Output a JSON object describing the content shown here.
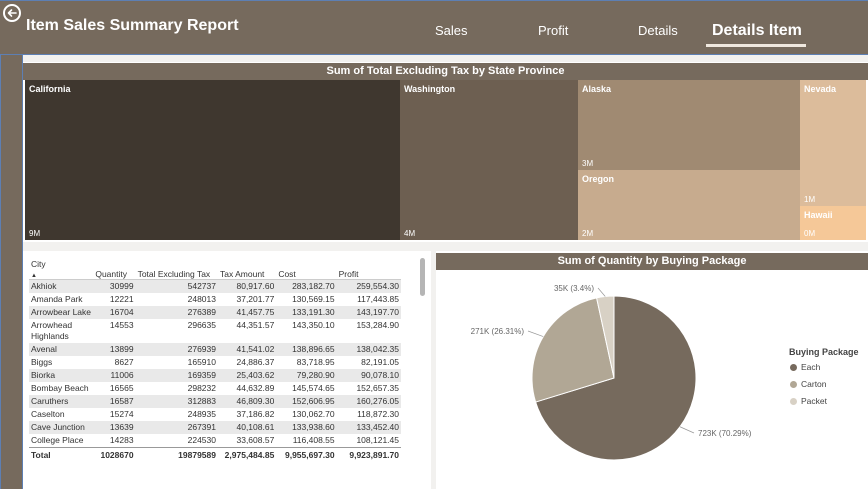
{
  "header": {
    "title": "Item Sales Summary Report",
    "nav": [
      "Sales",
      "Profit",
      "Details",
      "Details Item"
    ]
  },
  "treemap": {
    "title": "Sum of Total Excluding Tax by State Province",
    "tiles": [
      {
        "label": "California",
        "value": "9M",
        "color": "#3f372f"
      },
      {
        "label": "Washington",
        "value": "4M",
        "color": "#6d5f51"
      },
      {
        "label": "Alaska",
        "value": "3M",
        "color": "#a08a72"
      },
      {
        "label": "Oregon",
        "value": "2M",
        "color": "#c7ab8e"
      },
      {
        "label": "Nevada",
        "value": "1M",
        "color": "#dcbc9b"
      },
      {
        "label": "Hawaii",
        "value": "0M",
        "color": "#f5c898"
      }
    ]
  },
  "table": {
    "columns": [
      "City",
      "Quantity",
      "Total Excluding Tax",
      "Tax Amount",
      "Cost",
      "Profit"
    ],
    "rows": [
      [
        "Akhiok",
        "30999",
        "542737",
        "80,917.60",
        "283,182.70",
        "259,554.30"
      ],
      [
        "Amanda Park",
        "12221",
        "248013",
        "37,201.77",
        "130,569.15",
        "117,443.85"
      ],
      [
        "Arrowbear Lake",
        "16704",
        "276389",
        "41,457.75",
        "133,191.30",
        "143,197.70"
      ],
      [
        "Arrowhead Highlands",
        "14553",
        "296635",
        "44,351.57",
        "143,350.10",
        "153,284.90"
      ],
      [
        "Avenal",
        "13899",
        "276939",
        "41,541.02",
        "138,896.65",
        "138,042.35"
      ],
      [
        "Biggs",
        "8627",
        "165910",
        "24,886.37",
        "83,718.95",
        "82,191.05"
      ],
      [
        "Biorka",
        "11006",
        "169359",
        "25,403.62",
        "79,280.90",
        "90,078.10"
      ],
      [
        "Bombay Beach",
        "16565",
        "298232",
        "44,632.89",
        "145,574.65",
        "152,657.35"
      ],
      [
        "Caruthers",
        "16587",
        "312883",
        "46,809.30",
        "152,606.95",
        "160,276.05"
      ],
      [
        "Caselton",
        "15274",
        "248935",
        "37,186.82",
        "130,062.70",
        "118,872.30"
      ],
      [
        "Cave Junction",
        "13639",
        "267391",
        "40,108.61",
        "133,938.60",
        "133,452.40"
      ],
      [
        "College Place",
        "14283",
        "224530",
        "33,608.57",
        "116,408.55",
        "108,121.45"
      ]
    ],
    "total": [
      "Total",
      "1028670",
      "19879589",
      "2,975,484.85",
      "9,955,697.30",
      "9,923,891.70"
    ]
  },
  "pie": {
    "title": "Sum of Quantity by Buying Package",
    "legend_title": "Buying Package",
    "labels": [
      "723K (70.29%)",
      "271K (26.31%)",
      "35K (3.4%)"
    ]
  },
  "chart_data": {
    "type": "pie",
    "title": "Sum of Quantity by Buying Package",
    "legend_title": "Buying Package",
    "categories": [
      "Each",
      "Carton",
      "Packet"
    ],
    "values": [
      723000,
      271000,
      35000
    ],
    "percentages": [
      70.29,
      26.31,
      3.4
    ],
    "colors": [
      "#766a5d",
      "#b1a795",
      "#d8d1c5"
    ]
  }
}
